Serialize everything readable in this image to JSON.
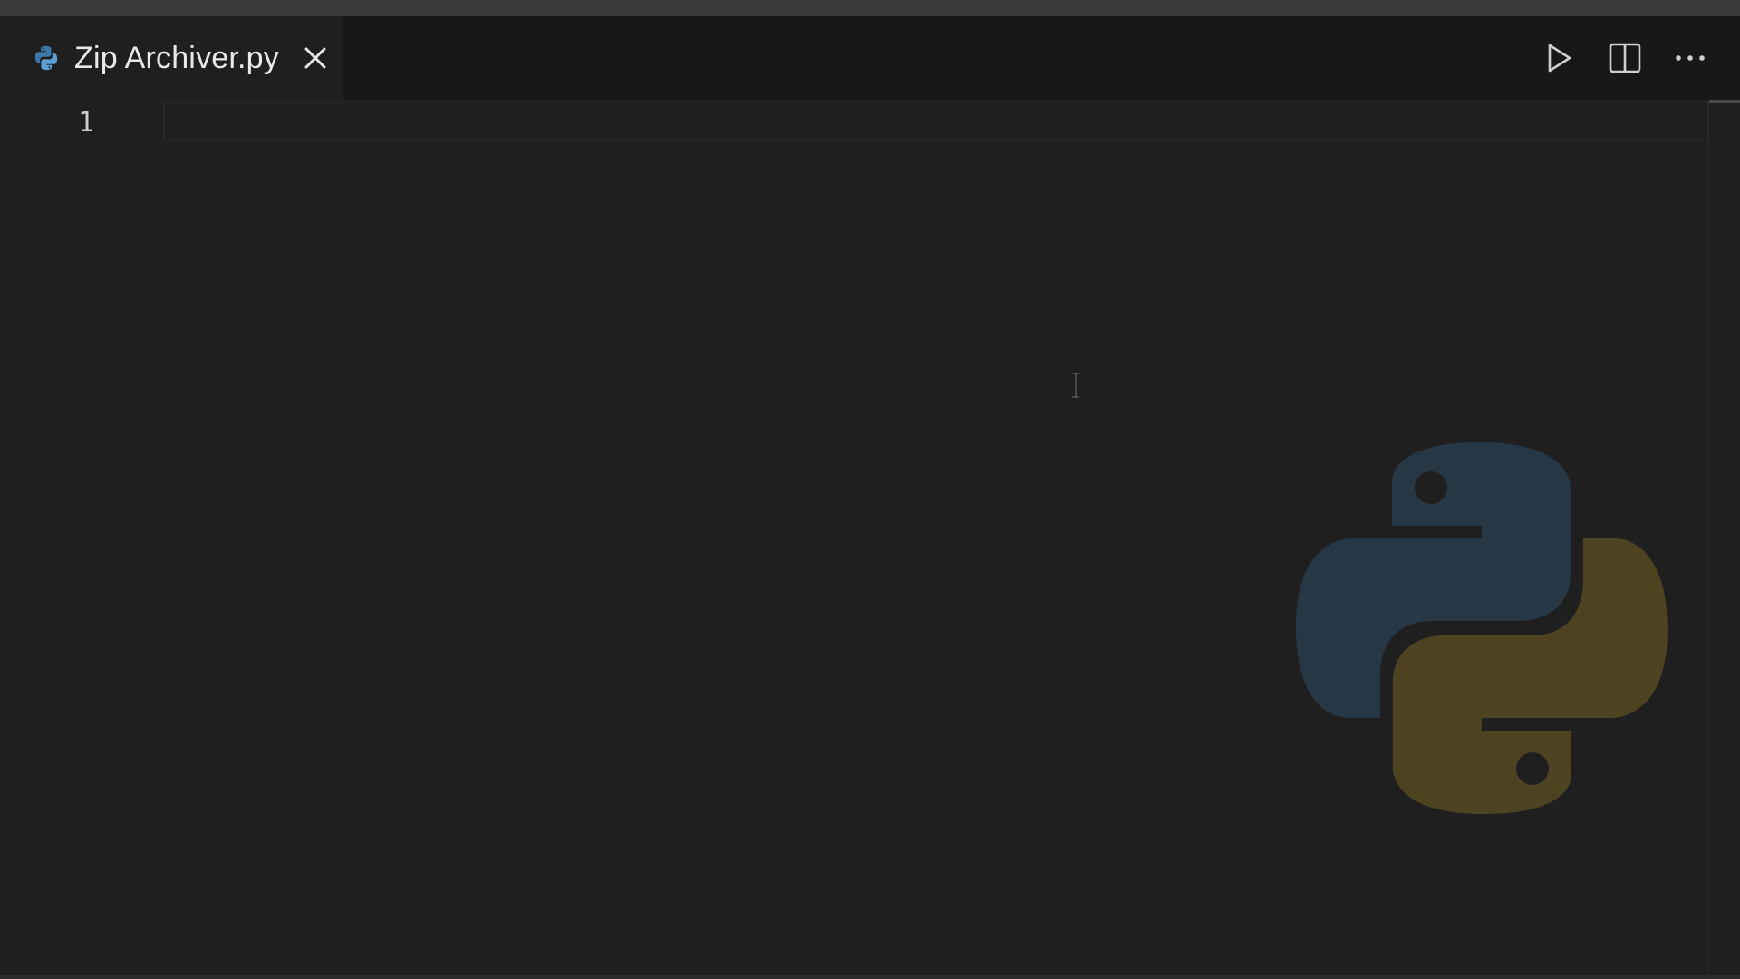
{
  "editor": {
    "tab": {
      "title": "Zip Archiver.py",
      "icon": "python-file-icon",
      "close_icon": "close-icon"
    },
    "toolbar": {
      "run_icon": "play-icon",
      "split_icon": "split-editor-icon",
      "more_icon": "more-actions-icon"
    },
    "lines": [
      {
        "number": "1",
        "text": ""
      }
    ],
    "watermark_icon": "python-logo-icon",
    "colors": {
      "background": "#1f1f1f",
      "tabbar": "#181818",
      "python_blue": "#3b77a8",
      "python_yellow": "#ffd43b"
    }
  }
}
